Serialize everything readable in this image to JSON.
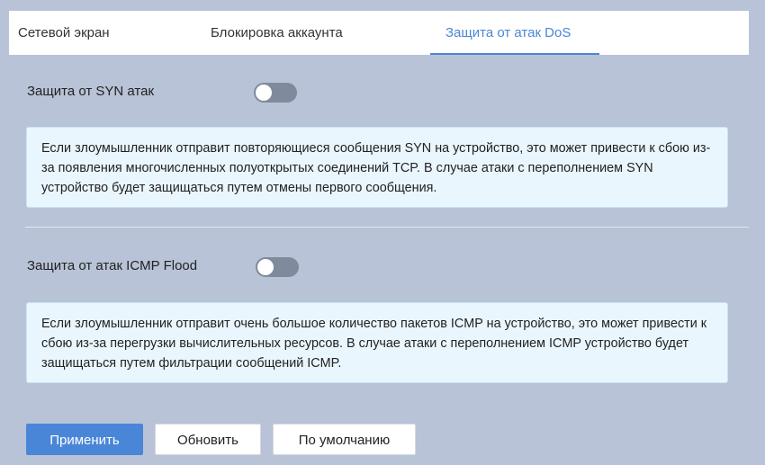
{
  "tabs": [
    {
      "label": "Сетевой экран",
      "active": false
    },
    {
      "label": "Блокировка аккаунта",
      "active": false
    },
    {
      "label": "Защита от атак DoS",
      "active": true
    }
  ],
  "syn": {
    "label": "Защита от SYN атак",
    "enabled": false,
    "info": "Если злоумышленник отправит повторяющиеся сообщения SYN на устройство, это может привести к сбою из-за появления многочисленных полуоткрытых соединений TCP. В случае атаки с переполнением SYN устройство будет защищаться путем отмены первого сообщения."
  },
  "icmp": {
    "label": "Защита от атак ICMP Flood",
    "enabled": false,
    "info": "Если злоумышленник отправит очень большое количество пакетов ICMP на устройство, это может привести к сбою из-за перегрузки вычислительных ресурсов. В случае атаки с переполнением ICMP устройство будет защищаться путем фильтрации сообщений ICMP."
  },
  "buttons": {
    "apply": "Применить",
    "refresh": "Обновить",
    "default": "По умолчанию"
  },
  "colors": {
    "accent": "#4a86d8",
    "background": "#b8c3d7",
    "info_background": "#eaf6fd",
    "toggle_off": "#7f8a9c"
  }
}
